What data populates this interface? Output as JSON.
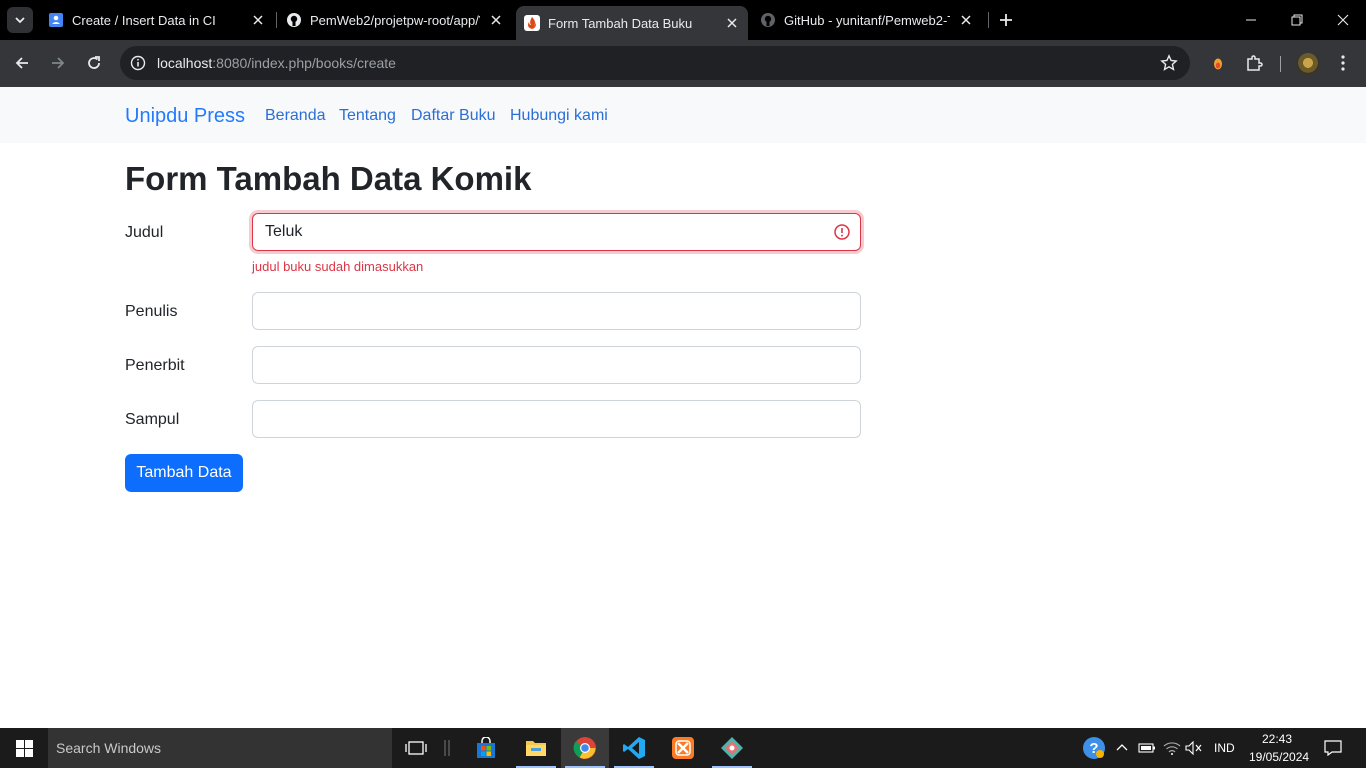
{
  "browser": {
    "tabs": [
      {
        "title": "Create / Insert Data in CI",
        "icon": "google-docs-icon",
        "active": false
      },
      {
        "title": "PemWeb2/projetpw-root/app/V",
        "icon": "github-icon",
        "active": false
      },
      {
        "title": "Form Tambah Data Buku",
        "icon": "codeigniter-icon",
        "active": true
      },
      {
        "title": "GitHub - yunitanf/Pemweb2-Tu",
        "icon": "github-icon",
        "active": false
      }
    ],
    "address": {
      "host": "localhost",
      "rest": ":8080/index.php/books/create"
    }
  },
  "navbar": {
    "brand": "Unipdu Press",
    "links": [
      "Beranda",
      "Tentang",
      "Daftar Buku",
      "Hubungi kami"
    ]
  },
  "form": {
    "title": "Form Tambah Data Komik",
    "judul_label": "Judul",
    "judul_value": "Teluk",
    "judul_error": "judul buku sudah dimasukkan",
    "penulis_label": "Penulis",
    "penulis_value": "",
    "penerbit_label": "Penerbit",
    "penerbit_value": "",
    "sampul_label": "Sampul",
    "sampul_value": "",
    "submit_label": "Tambah Data"
  },
  "taskbar": {
    "search_placeholder": "Search Windows",
    "language": "IND",
    "time": "22:43",
    "date": "19/05/2024"
  },
  "colors": {
    "primary": "#0d6efd",
    "danger": "#dc3545",
    "navbar_bg": "#f8f9fa"
  }
}
